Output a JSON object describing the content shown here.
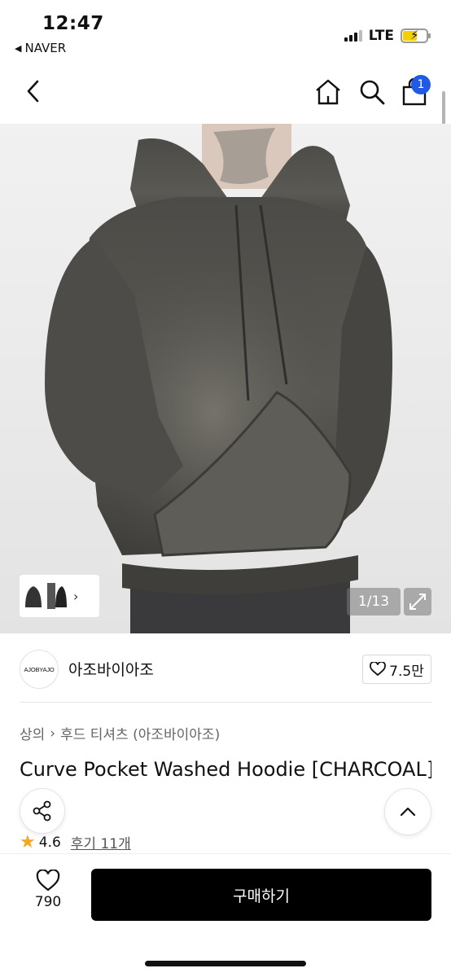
{
  "status_bar": {
    "time": "12:47",
    "back_app": "NAVER",
    "network": "LTE"
  },
  "nav": {
    "cart_count": "1",
    "icons": [
      "chevron-left-icon",
      "home-icon",
      "search-icon",
      "shopping-bag-icon"
    ]
  },
  "gallery": {
    "counter": "1/13"
  },
  "brand": {
    "logo_text": "AJOBYAJO",
    "name": "아조바이아조",
    "likes": "7.5만"
  },
  "breadcrumb": {
    "category": "상의",
    "subcategory": "후드 티셔츠 (아조바이아조)"
  },
  "product": {
    "title": "Curve Pocket Washed Hoodie [CHARCOAL]",
    "rating": "4.6",
    "reviews": "후기 11개"
  },
  "action_bar": {
    "wish_count": "790",
    "buy_label": "구매하기"
  },
  "colors": {
    "badge": "#1f5ae6",
    "star": "#f5a623",
    "buy_button": "#000000"
  }
}
